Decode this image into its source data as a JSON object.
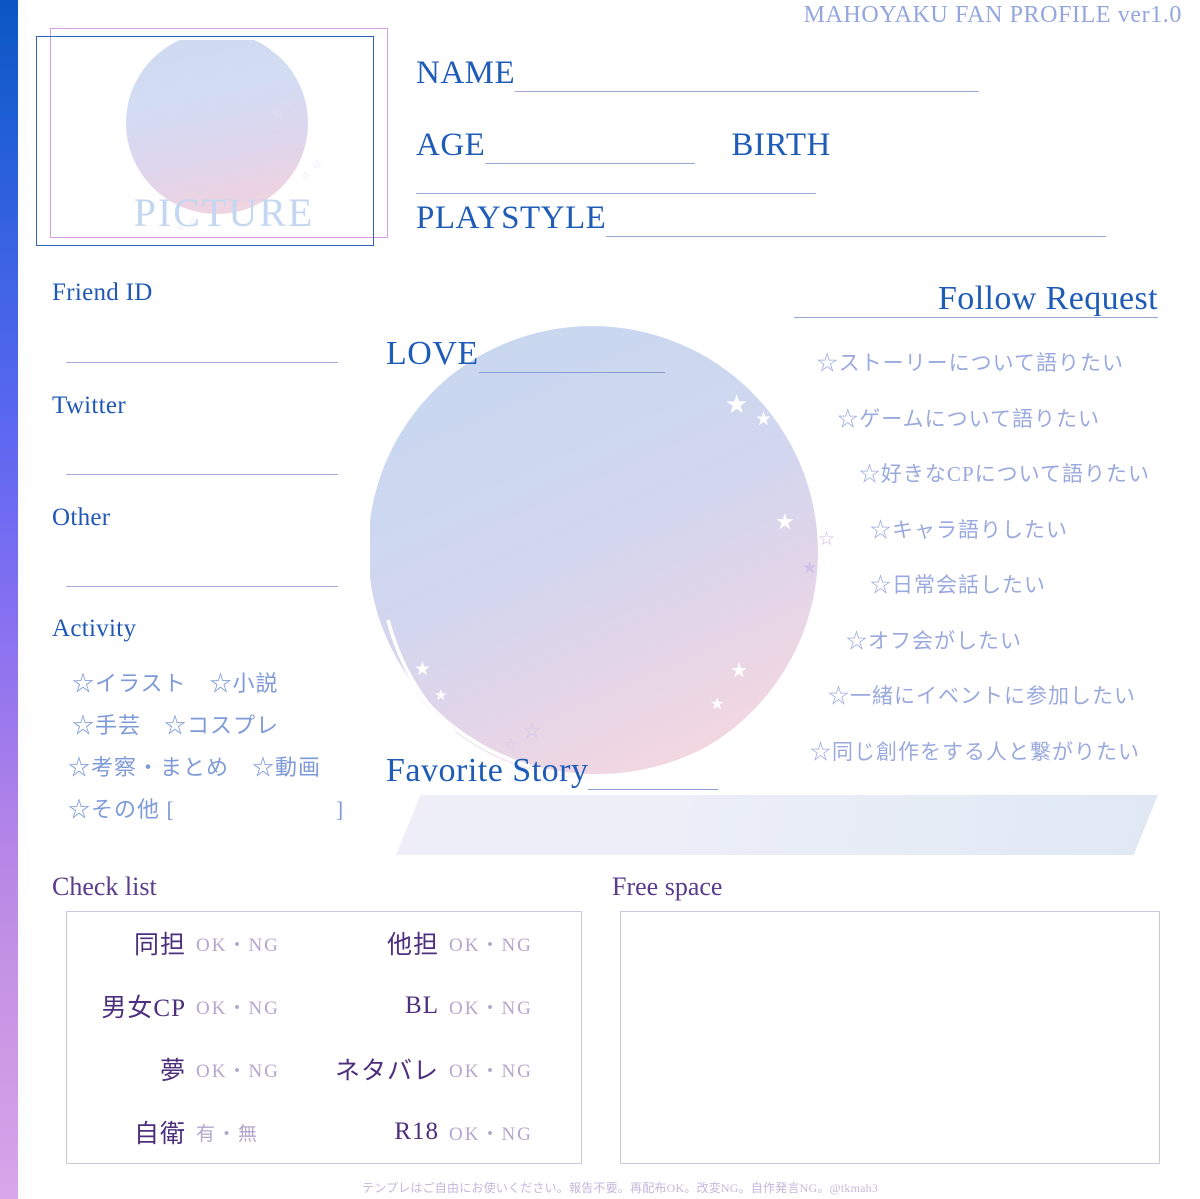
{
  "header": {
    "title": "MAHOYAKU FAN PROFILE ver1.0"
  },
  "picture": {
    "label": "PICTURE"
  },
  "fields": {
    "name": "NAME",
    "age": "AGE",
    "birth": "BIRTH",
    "playstyle": "PLAYSTYLE"
  },
  "contacts": {
    "friend_id": "Friend ID",
    "twitter": "Twitter",
    "other": "Other"
  },
  "activity": {
    "title": "Activity",
    "lines": [
      "☆イラスト　☆小説",
      "☆手芸　☆コスプレ",
      "☆考察・まとめ　☆動画",
      "☆その他 [　　　　　　　]"
    ]
  },
  "middle": {
    "love": "LOVE",
    "favorite_story": "Favorite Story"
  },
  "follow_request": {
    "title": "Follow Request",
    "items": [
      "☆ストーリーについて語りたい",
      "☆ゲームについて語りたい",
      "☆好きなCPについて語りたい",
      "☆キャラ語りしたい",
      "☆日常会話したい",
      "☆オフ会がしたい",
      "☆一緒にイベントに参加したい",
      "☆同じ創作をする人と繋がりたい"
    ]
  },
  "check_list": {
    "title": "Check list",
    "rows": [
      {
        "left_label": "同担",
        "left_opts": "OK・NG",
        "right_label": "他担",
        "right_opts": "OK・NG"
      },
      {
        "left_label": "男女CP",
        "left_opts": "OK・NG",
        "right_label": "BL",
        "right_opts": "OK・NG"
      },
      {
        "left_label": "夢",
        "left_opts": "OK・NG",
        "right_label": "ネタバレ",
        "right_opts": "OK・NG"
      },
      {
        "left_label": "自衛",
        "left_opts": "有・無",
        "right_label": "R18",
        "right_opts": "OK・NG"
      }
    ]
  },
  "free_space": {
    "title": "Free space"
  },
  "footer": {
    "text": "テンプレはご自由にお使いください。報告不要。再配布OK。改変NG。自作発言NG。@tkmah3"
  },
  "colors": {
    "accent_blue": "#1f5cb8",
    "header_blue": "#93a6dd",
    "soft_blue": "#7e9ad8",
    "purple": "#5b3b8c",
    "light_purple": "#b3a7cd",
    "pink_frame": "#d69fe0"
  }
}
